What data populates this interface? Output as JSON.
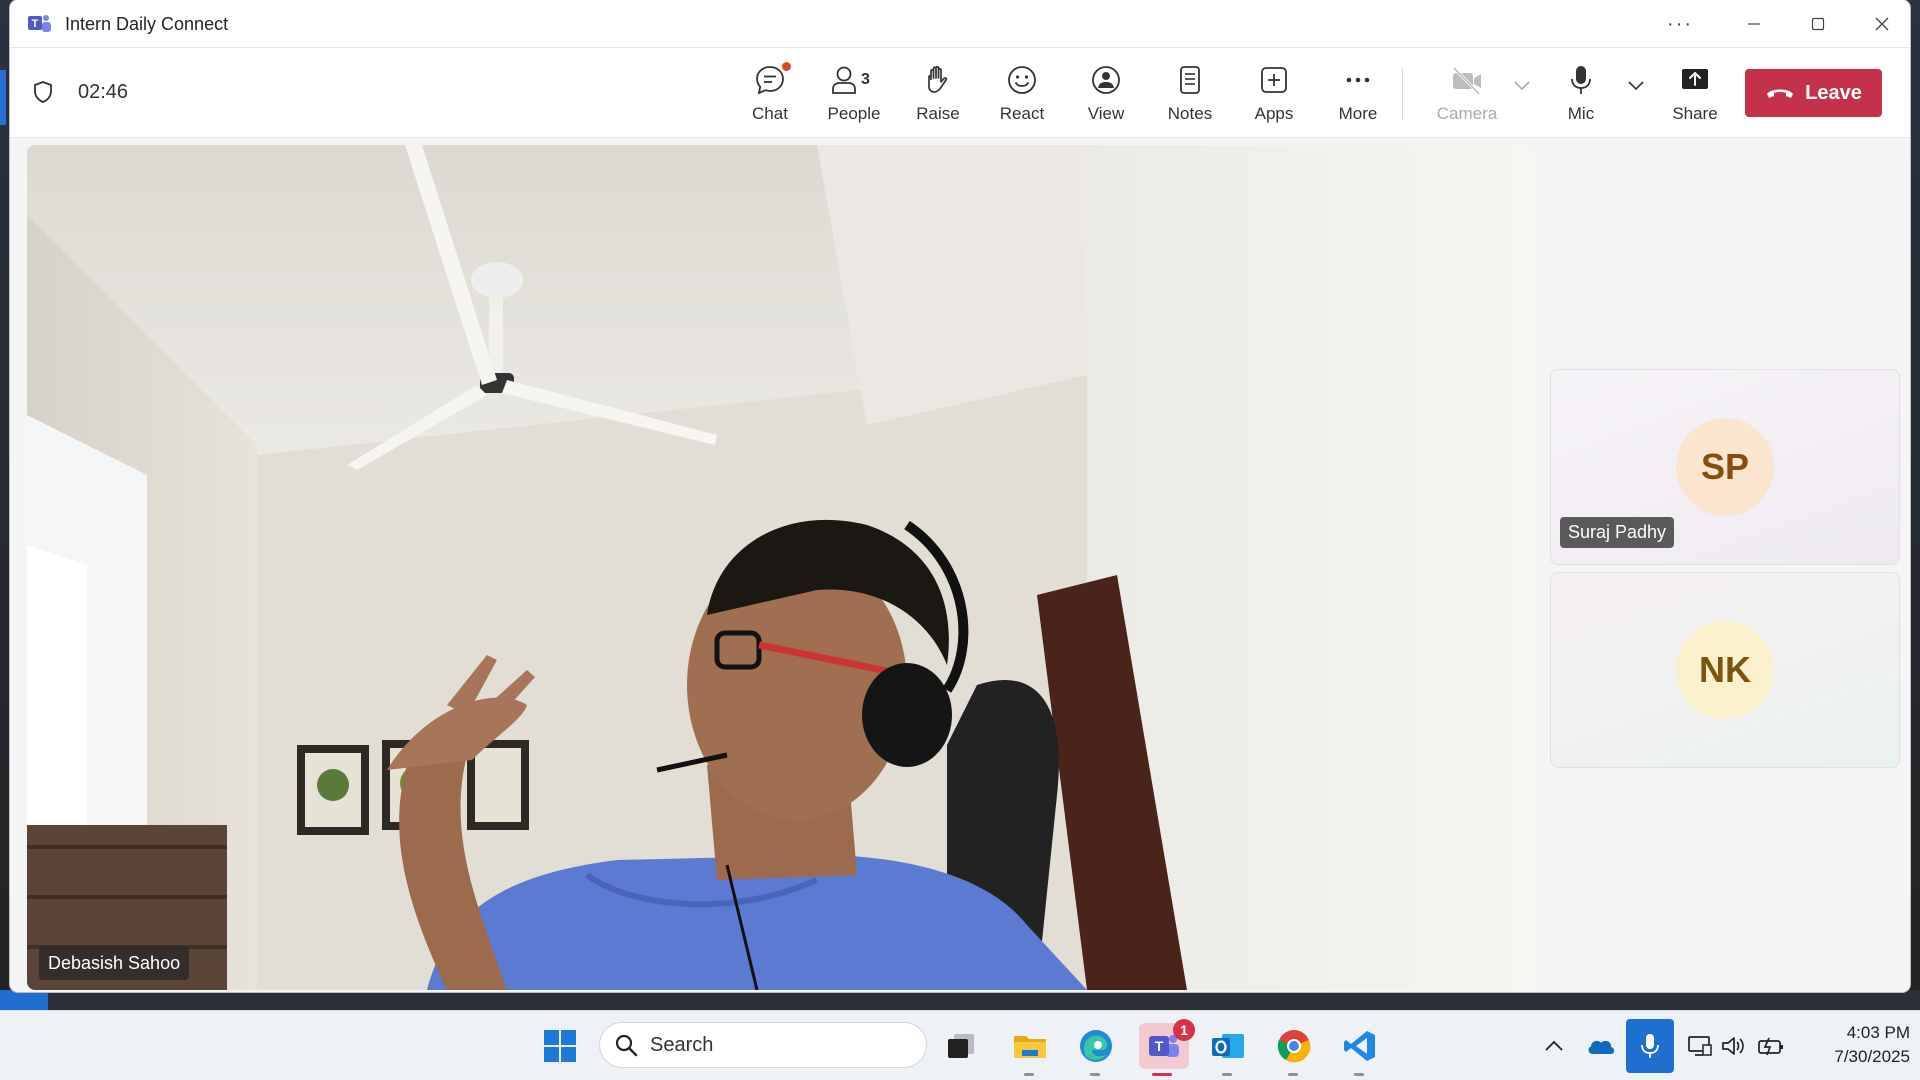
{
  "window": {
    "title": "Intern Daily Connect"
  },
  "toolbar": {
    "timer": "02:46",
    "buttons": [
      {
        "label": "Chat",
        "icon": "chat-icon"
      },
      {
        "label": "People",
        "icon": "people-icon",
        "count": "3"
      },
      {
        "label": "Raise",
        "icon": "raise-hand-icon"
      },
      {
        "label": "React",
        "icon": "smiley-icon"
      },
      {
        "label": "View",
        "icon": "view-icon"
      },
      {
        "label": "Notes",
        "icon": "notes-icon"
      },
      {
        "label": "Apps",
        "icon": "plus-square-icon"
      },
      {
        "label": "More",
        "icon": "ellipsis-icon"
      },
      {
        "label": "Camera",
        "icon": "camera-off-icon",
        "disabled": true
      },
      {
        "label": "Mic",
        "icon": "mic-icon"
      },
      {
        "label": "Share",
        "icon": "share-icon"
      }
    ],
    "leave_label": "Leave",
    "leave_color": "#c4314b"
  },
  "stage": {
    "speaker_name": "Debasish Sahoo"
  },
  "participants": [
    {
      "initials": "SP",
      "name": "Suraj Padhy"
    },
    {
      "initials": "NK",
      "name": ""
    }
  ],
  "taskbar": {
    "search_placeholder": "Search",
    "teams_badge": "1",
    "time": "4:03 PM",
    "date": "7/30/2025"
  }
}
